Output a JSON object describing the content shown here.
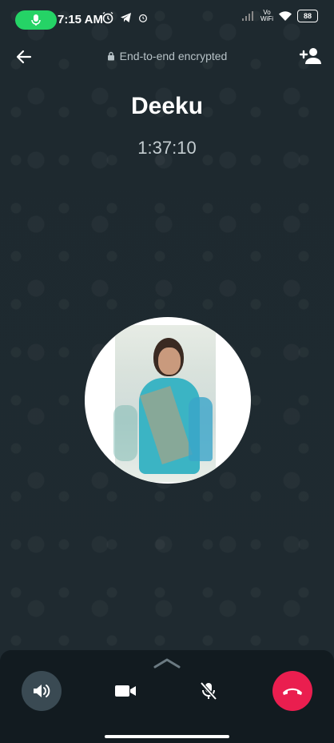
{
  "status_bar": {
    "time": "7:15 AM",
    "network_label_top": "Vo",
    "network_label_bottom": "WiFi",
    "battery": "88"
  },
  "header": {
    "encryption_text": "End-to-end encrypted"
  },
  "call": {
    "contact_name": "Deeku",
    "duration": "1:37:10"
  },
  "controls": {
    "items": [
      "speaker",
      "video",
      "mute",
      "end-call"
    ]
  },
  "colors": {
    "background": "#1f2a30",
    "accent_green": "#25d366",
    "end_call_red": "#ea1e4f",
    "controls_bg": "#121b20"
  }
}
